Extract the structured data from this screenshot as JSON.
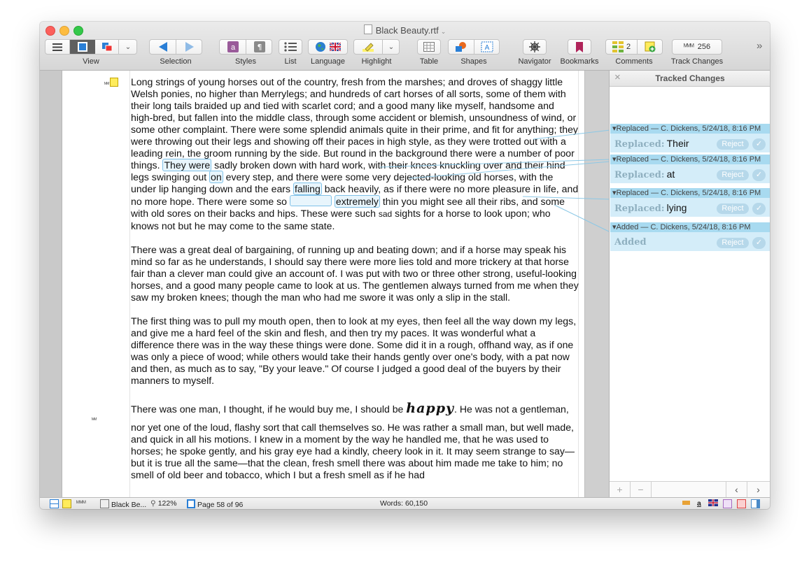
{
  "window": {
    "title": "Black Beauty.rtf"
  },
  "toolbar": {
    "view": "View",
    "selection": "Selection",
    "styles": "Styles",
    "list": "List",
    "language": "Language",
    "highlight": "Highlight",
    "table": "Table",
    "shapes": "Shapes",
    "navigator": "Navigator",
    "bookmarks": "Bookmarks",
    "comments": "Comments",
    "comments_count": "2",
    "track_changes": "Track Changes",
    "track_count": "256"
  },
  "document": {
    "p1": {
      "a": "Long strings of young horses out of the country, fresh from the marshes; and droves of shaggy little Welsh ponies, no higher than Merrylegs; and hundreds of cart horses of all sorts, some of them with their long tails braided up and tied with scarlet cord; and a good many like myself, handsome and high-bred, but fallen into the middle class, through some accident or blemish, unsoundness of wind, or some other complaint. There were some splendid animals quite in their prime, and fit for anything; they were throwing out their legs and showing off their paces in high style, as they were trotted out with a leading rein, the groom running by the side. But round in the background there were a number of poor things.",
      "m1": "They were",
      "b": "sadly broken down with hard work, with their knees knuckling over and their hind legs swinging out",
      "m2": "on",
      "c": "every step, and there were some very dejected-looking old horses, with the under lip hanging down and the ears",
      "m3": "falling",
      "d": "back heavily, as if there were no more pleasure in life, and no more hope. There were some so",
      "m4": "extremely",
      "e": "thin you might see all their ribs, and some with old sores on their backs and hips. These were such",
      "e_small": "sad",
      "f": "sights for a horse to look upon; who knows not but he may come to the same state."
    },
    "p2": "There was a great deal of bargaining, of running up and beating down; and if a horse may speak his mind so far as he understands, I should say there were more lies told and more trickery at that horse fair than a clever man could give an account of. I was put with two or three other strong, useful-looking horses, and a good many people came to look at us. The gentlemen always turned from me when they saw my broken knees; though the man who had me swore it was only a slip in the stall.",
    "p3": "The first thing was to pull my mouth open, then to look at my eyes, then feel all the way down my legs, and give me a hard feel of the skin and flesh, and then try my paces. It was wonderful what a difference there was in the way these things were done. Some did it in a rough, offhand way, as if one was only a piece of wood; while others would take their hands gently over one's body, with a pat now and then, as much as to say, \"By your leave.\" Of course I judged a good deal of the buyers by their manners to myself.",
    "p4a": "There was one man, I thought, if he would buy me, I should be",
    "p4_happy": "happy",
    "p4b": ". He was not a gentleman,",
    "p5": "nor yet one of the loud, flashy sort that call themselves so. He was rather a small man, but well made, and quick in all his motions. I knew in a moment by the way he handled me, that he was used to horses; he spoke gently, and his gray eye had a kindly, cheery look in it. It may seem strange to say—but it is true all the same—that the clean, fresh smell there was about him made me take to him; no smell of old beer and tobacco, which I but a fresh smell as if he had"
  },
  "panel": {
    "title": "Tracked Changes",
    "reject": "Reject",
    "changes": [
      {
        "header": "Replaced — C. Dickens, 5/24/18, 8:16 PM",
        "label": "Replaced:",
        "text": "Their"
      },
      {
        "header": "Replaced — C. Dickens, 5/24/18, 8:16 PM",
        "label": "Replaced:",
        "text": "at"
      },
      {
        "header": "Replaced — C. Dickens, 5/24/18, 8:16 PM",
        "label": "Replaced:",
        "text": "lying"
      },
      {
        "header": "Added — C. Dickens, 5/24/18, 8:16 PM",
        "label": "Added",
        "text": ""
      }
    ]
  },
  "status": {
    "doc_name": "Black Be...",
    "zoom": "122%",
    "page": "Page 58 of 96",
    "words": "Words: 60,150"
  }
}
